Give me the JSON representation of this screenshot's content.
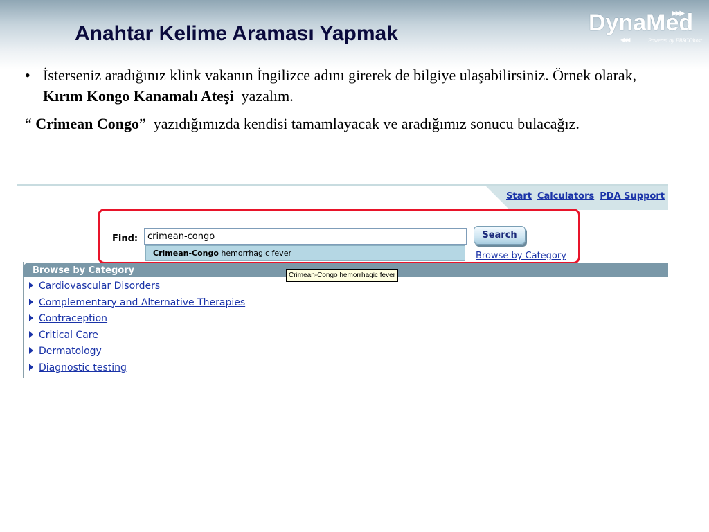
{
  "slide": {
    "title": "Anahtar Kelime Araması Yapmak",
    "logo": {
      "name": "DynaMed",
      "tagline": "Powered by EBSCOhost"
    },
    "bullet_char": "•",
    "p1_line": "İsterseniz aradığınız klink vakanın İngilizce adını girerek de bilgiye ulaşabilirsiniz. Örnek olarak,",
    "p1_bold": "Kırım Kongo Kanamalı Ateşi",
    "p1_end": "yazalım.",
    "p2_open_quote": "“",
    "p2_bold": "Crimean Congo",
    "p2_close_quote": "”",
    "p2_rest": "yazıdığımızda kendisi tamamlayacak ve aradığımız sonucu bulacağız."
  },
  "app": {
    "nav": [
      "Start",
      "Calculators",
      "PDA Support"
    ],
    "find_label": "Find:",
    "search_value": "crimean-congo",
    "suggestion_bold": "Crimean-Congo",
    "suggestion_rest": " hemorrhagic fever",
    "search_button": "Search",
    "browse_link": "Browse by Category",
    "browse_header": "Browse by Category",
    "tooltip": "Crimean-Congo hemorrhagic fever",
    "categories": [
      "Cardiovascular Disorders",
      "Complementary and Alternative Therapies",
      "Contraception",
      "Critical Care",
      "Dermatology",
      "Diagnostic testing"
    ],
    "colors": {
      "link": "#1a33a8",
      "highlight": "#e8142a",
      "browse_bar": "#7a98a8",
      "suggestion_bg": "#b5d7e4"
    }
  }
}
